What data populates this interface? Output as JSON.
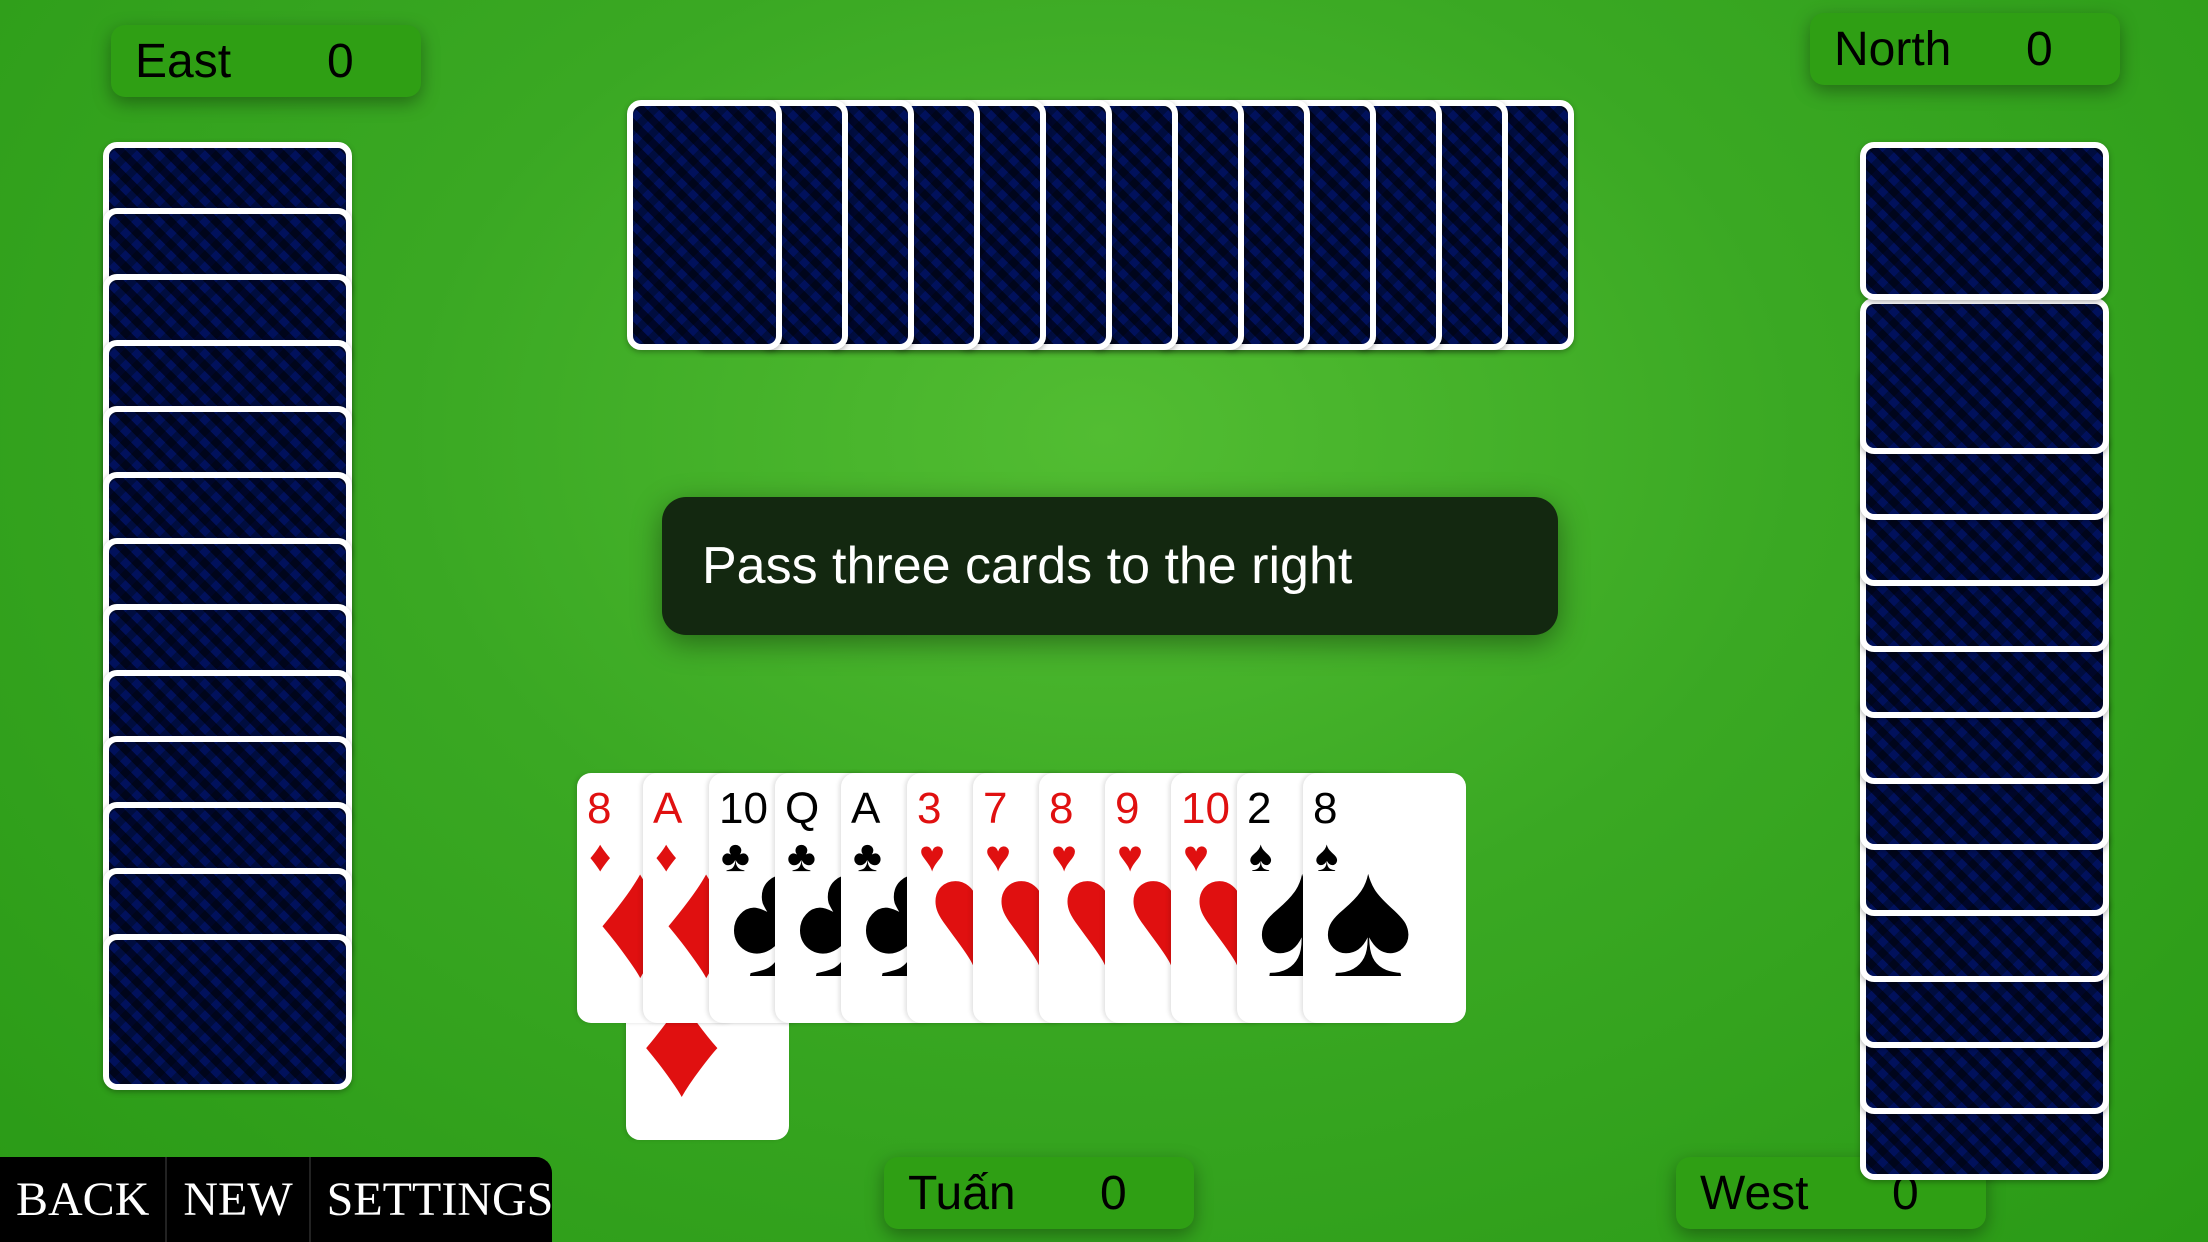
{
  "players": [
    {
      "name": "East",
      "score": "0"
    },
    {
      "name": "North",
      "score": "0"
    },
    {
      "name": "Tuấn",
      "score": "0"
    },
    {
      "name": "West",
      "score": "0"
    }
  ],
  "message": "Pass three cards to the right",
  "hand": [
    {
      "rank": "8",
      "suit": "♦",
      "color": "red"
    },
    {
      "rank": "A",
      "suit": "♦",
      "color": "red"
    },
    {
      "rank": "10",
      "suit": "♣",
      "color": "blk"
    },
    {
      "rank": "Q",
      "suit": "♣",
      "color": "blk"
    },
    {
      "rank": "A",
      "suit": "♣",
      "color": "blk"
    },
    {
      "rank": "3",
      "suit": "♥",
      "color": "red"
    },
    {
      "rank": "7",
      "suit": "♥",
      "color": "red"
    },
    {
      "rank": "8",
      "suit": "♥",
      "color": "red"
    },
    {
      "rank": "9",
      "suit": "♥",
      "color": "red"
    },
    {
      "rank": "10",
      "suit": "♥",
      "color": "red"
    },
    {
      "rank": "2",
      "suit": "♠",
      "color": "blk"
    },
    {
      "rank": "8",
      "suit": "♠",
      "color": "blk"
    }
  ],
  "opponent_card_counts": {
    "east": 13,
    "north": 13,
    "west": 13
  },
  "menu": {
    "back": "BACK",
    "new": "NEW",
    "settings": "SETTINGS"
  },
  "colors": {
    "table": "#3aa823",
    "card_back": "#1a6fd6",
    "message_bg": "#132810"
  }
}
